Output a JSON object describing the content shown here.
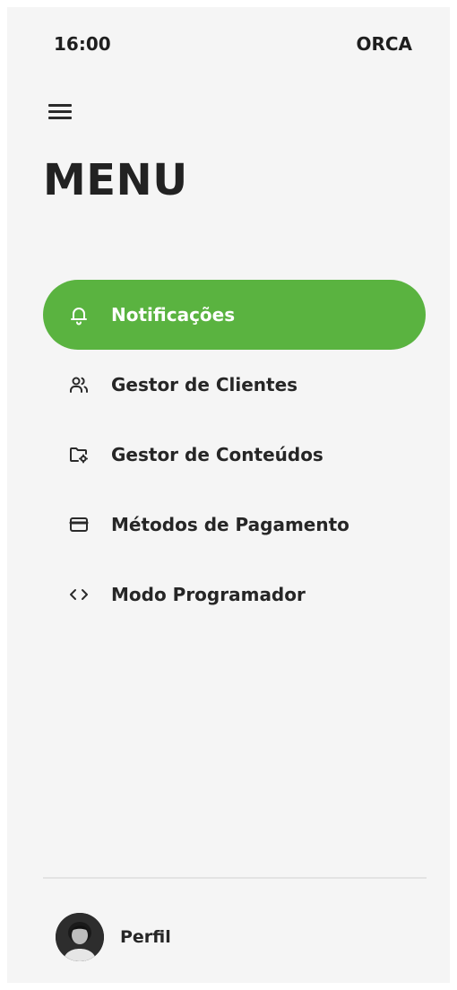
{
  "status_bar": {
    "time": "16:00",
    "carrier": "ORCA"
  },
  "header": {
    "menu_icon": "hamburger-icon",
    "title": "MENU"
  },
  "menu": {
    "items": [
      {
        "label": "Notificações",
        "icon": "bell-icon",
        "active": true
      },
      {
        "label": "Gestor de Clientes",
        "icon": "users-icon",
        "active": false
      },
      {
        "label": "Gestor de Conteúdos",
        "icon": "folder-settings-icon",
        "active": false
      },
      {
        "label": "Métodos de Pagamento",
        "icon": "credit-card-icon",
        "active": false
      },
      {
        "label": "Modo Programador",
        "icon": "code-icon",
        "active": false
      }
    ]
  },
  "profile": {
    "label": "Perfil",
    "avatar_icon": "avatar"
  },
  "colors": {
    "accent": "#5ab340",
    "background": "#f5f5f5",
    "text": "#262626"
  }
}
